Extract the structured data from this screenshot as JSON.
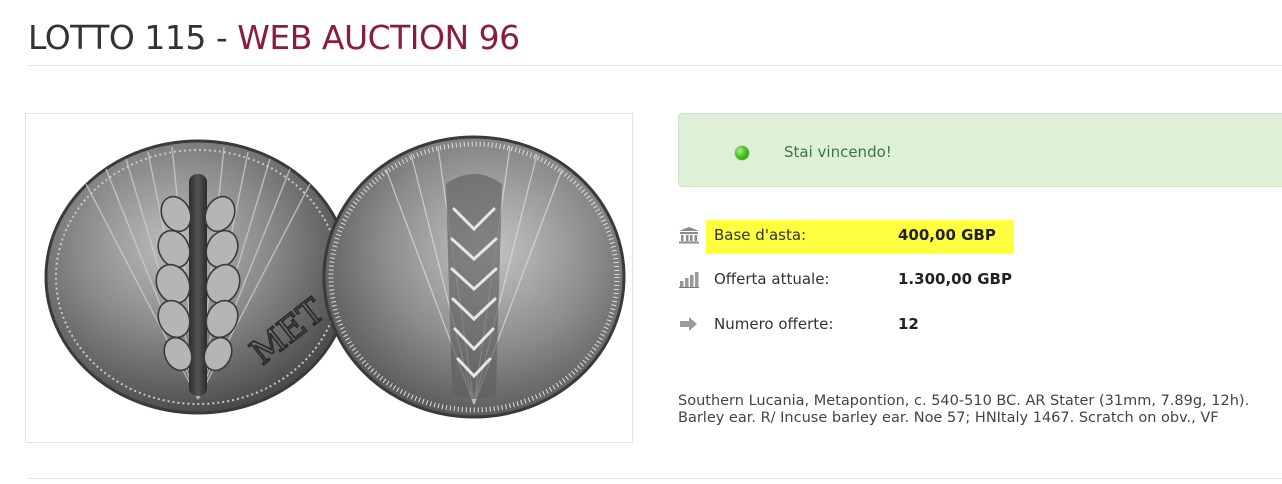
{
  "header": {
    "lot_prefix": "LOTTO 115 - ",
    "auction_name": "WEB AUCTION 96"
  },
  "status": {
    "message": "Stai vincendo!",
    "indicator_color": "#3fbf1f"
  },
  "details": [
    {
      "icon": "bank-icon",
      "label": "Base d'asta:",
      "value": "400,00 GBP",
      "highlighted": true
    },
    {
      "icon": "bar-chart-icon",
      "label": "Offerta attuale:",
      "value": "1.300,00 GBP",
      "highlighted": false
    },
    {
      "icon": "arrow-right-icon",
      "label": "Numero offerte:",
      "value": "12",
      "highlighted": false
    }
  ],
  "description": "Southern Lucania, Metapontion, c. 540-510 BC. AR Stater (31mm, 7.89g, 12h). Barley ear. R/ Incuse barley ear. Noe 57; HNItaly 1467. Scratch on obv., VF",
  "image": {
    "coin_legend": "MET",
    "subject": "coin-photo"
  },
  "colors": {
    "accent": "#8b1d3a",
    "success_bg": "#dff0d8",
    "highlight": "#ffff40"
  }
}
